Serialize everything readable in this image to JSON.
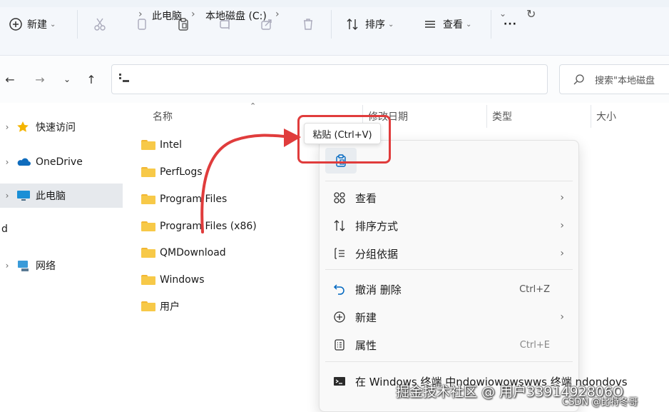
{
  "ribbon": {
    "new_label": "新建",
    "sort_label": "排序",
    "view_label": "查看",
    "more_label": "···"
  },
  "address": {
    "path": [
      "此电脑",
      "本地磁盘 (C:)"
    ],
    "search_placeholder": "搜索\"本地磁盘"
  },
  "sidebar": {
    "items": [
      {
        "label": "快速访问"
      },
      {
        "label": "OneDrive"
      },
      {
        "label": "此电脑"
      },
      {
        "label": "d"
      },
      {
        "label": "网络"
      }
    ]
  },
  "columns": {
    "name": "名称",
    "modified": "修改日期",
    "type": "类型",
    "size": "大小"
  },
  "files": [
    "Intel",
    "PerfLogs",
    "Program Files",
    "Program Files (x86)",
    "QMDownload",
    "Windows",
    "用户"
  ],
  "context_menu": {
    "tooltip": "粘贴 (Ctrl+V)",
    "items": [
      {
        "label": "查看"
      },
      {
        "label": "排序方式"
      },
      {
        "label": "分组依据"
      },
      {
        "label": "撤消 删除",
        "shortcut": "Ctrl+Z"
      },
      {
        "label": "新建"
      },
      {
        "label": "属性",
        "shortcut": "Ctrl+E"
      },
      {
        "label": "在 Windows 终端 中ndowiowowswws 终端 ndondovs"
      }
    ]
  },
  "watermark": {
    "main": "掘金技术社区 @ 用户3391492806O",
    "sub": "CSDN @比特冬哥"
  },
  "colors": {
    "highlight": "#e03c3c",
    "arrow": "#e03c3c",
    "folder": "#f7c948",
    "accent": "#0067c0"
  }
}
